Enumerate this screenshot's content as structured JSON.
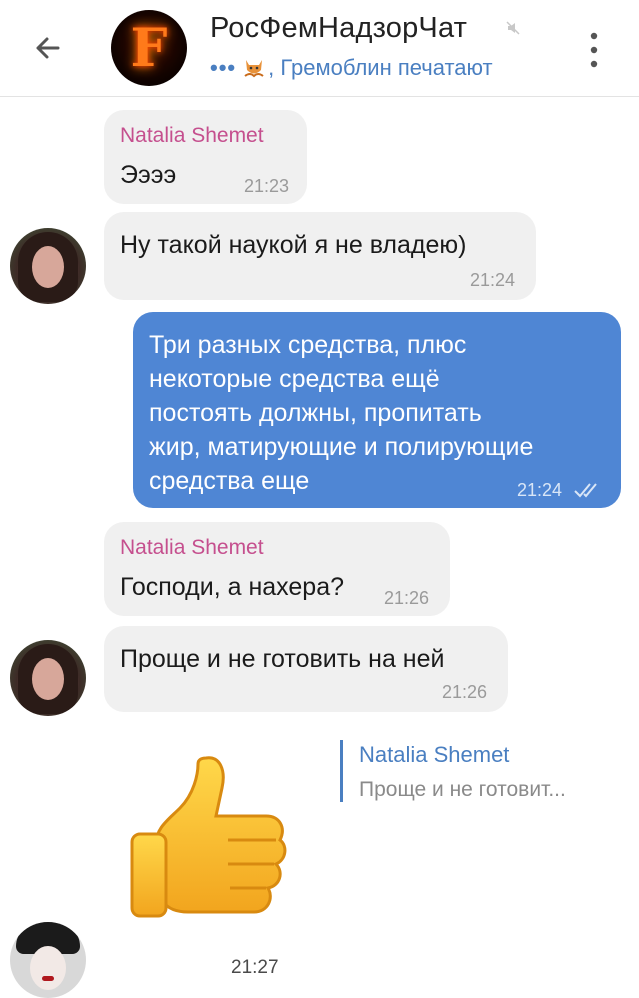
{
  "header": {
    "title": "РосФемНадзорЧат",
    "typing_dots": "•••",
    "typing_text": ", Гремоблин печатают",
    "avatar_letter": "F"
  },
  "messages": [
    {
      "sender": "Natalia Shemet",
      "text": "Ээээ",
      "time": "21:23"
    },
    {
      "text": "Ну такой наукой я не владею)",
      "time": "21:24"
    },
    {
      "lines": [
        "Три разных средства, плюс",
        "некоторые средства ещё",
        "постоять должны, пропитать",
        "жир, матирующие и полирующие",
        "средства еще"
      ],
      "time": "21:24"
    },
    {
      "sender": "Natalia Shemet",
      "text": "Господи, а нахера?",
      "time": "21:26"
    },
    {
      "text": "Проще и не готовить на ней",
      "time": "21:26"
    }
  ],
  "reply": {
    "name": "Natalia Shemet",
    "text": "Проще и не готовит..."
  },
  "sticker": {
    "icon": "thumbs-up-icon",
    "time": "21:27"
  },
  "colors": {
    "accent": "#4a7fc1",
    "outgoing": "#4f86d4",
    "incoming": "#f0f0f0",
    "sender_name": "#c54f8e"
  }
}
